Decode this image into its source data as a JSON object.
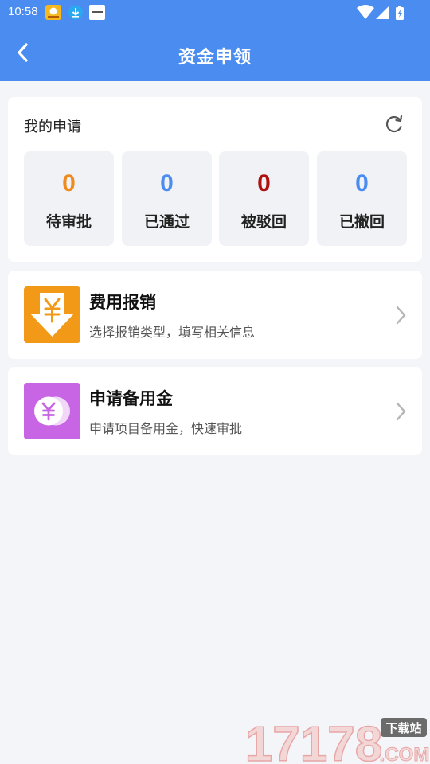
{
  "status_bar": {
    "time": "10:58",
    "notification_icons": [
      "app-notification-icon",
      "download-icon",
      "app-badge-icon"
    ],
    "system_icons": [
      "wifi-icon",
      "signal-icon",
      "battery-icon"
    ]
  },
  "nav": {
    "title": "资金申领",
    "back_icon": "chevron-left-icon"
  },
  "my_applications": {
    "title": "我的申请",
    "refresh_icon": "refresh-icon",
    "stats": [
      {
        "count": "0",
        "label": "待审批",
        "color": "#f08a1c"
      },
      {
        "count": "0",
        "label": "已通过",
        "color": "#4a8cf0"
      },
      {
        "count": "0",
        "label": "被驳回",
        "color": "#b01010"
      },
      {
        "count": "0",
        "label": "已撤回",
        "color": "#4a8cf0"
      }
    ]
  },
  "entries": [
    {
      "title": "费用报销",
      "desc": "选择报销类型，填写相关信息",
      "icon": "yen-download-icon",
      "icon_color": "#f29a17"
    },
    {
      "title": "申请备用金",
      "desc": "申请项目备用金，快速审批",
      "icon": "yen-coins-icon",
      "icon_color": "#c865e4"
    }
  ],
  "watermark": {
    "text": "17178",
    "suffix": ".COM",
    "badge": "下载站"
  },
  "colors": {
    "header": "#4a8cf0",
    "background": "#f4f5f9"
  }
}
